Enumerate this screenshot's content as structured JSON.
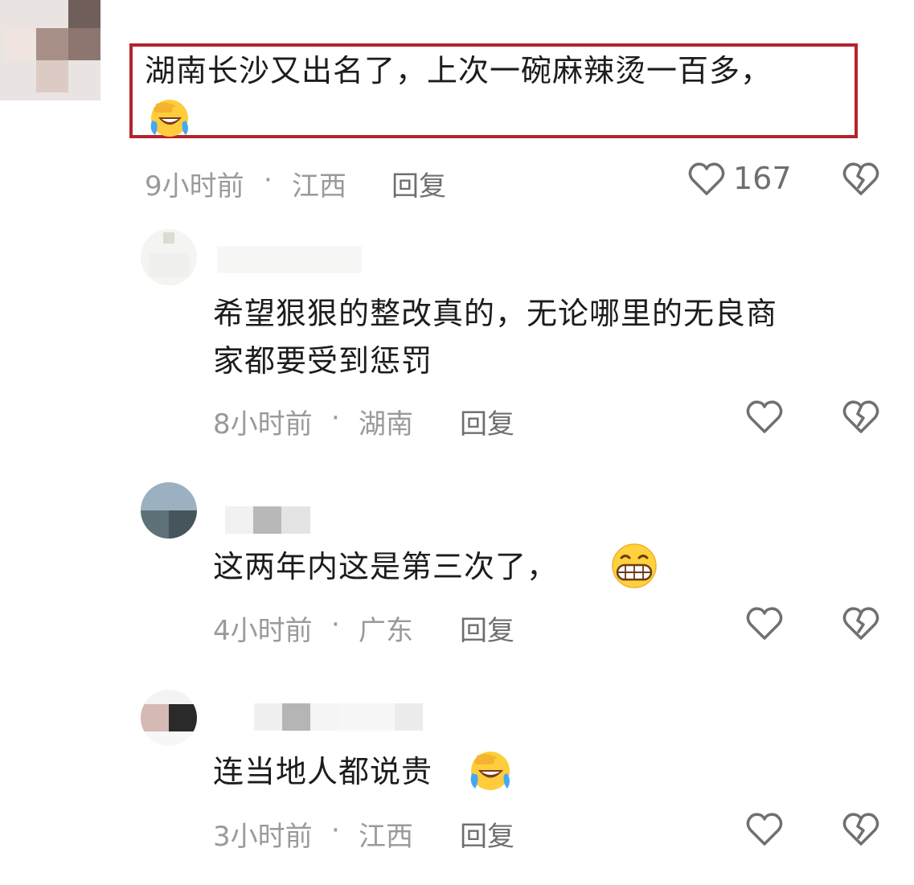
{
  "comments": [
    {
      "text_line1": "湖南长沙又出名了，上次一碗麻辣烫一百多，",
      "time": "9小时前",
      "separator": "·",
      "location": "江西",
      "reply_label": "回复",
      "like_count": "167",
      "emoji": "facepalm-crying-laughing"
    },
    {
      "text_line1": "希望狠狠的整改真的，无论哪里的无良商",
      "text_line2": "家都要受到惩罚",
      "time": "8小时前",
      "separator": "·",
      "location": "湖南",
      "reply_label": "回复"
    },
    {
      "text_line1": "这两年内这是第三次了，",
      "time": "4小时前",
      "separator": "·",
      "location": "广东",
      "reply_label": "回复",
      "emoji": "grinning"
    },
    {
      "text_line1": "连当地人都说贵",
      "time": "3小时前",
      "separator": "·",
      "location": "江西",
      "reply_label": "回复",
      "emoji": "facepalm-crying-laughing"
    }
  ],
  "colors": {
    "highlight": "#b3232a",
    "meta_text": "#9a9a9a",
    "icon_gray": "#707070"
  }
}
